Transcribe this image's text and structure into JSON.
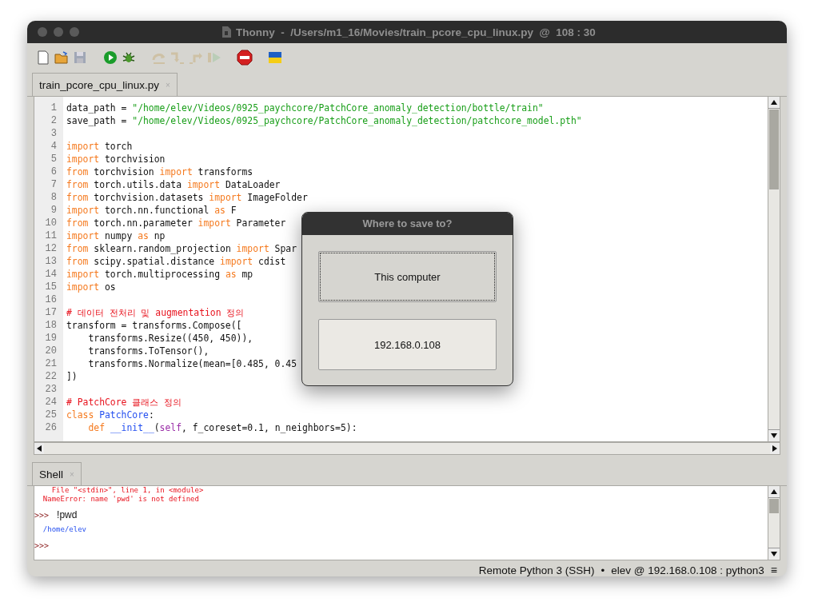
{
  "window": {
    "title": "Thonny  -  /Users/m1_16/Movies/train_pcore_cpu_linux.py  @  108 : 30"
  },
  "toolbar": [
    {
      "kind": "new",
      "disabled": false
    },
    {
      "kind": "open",
      "disabled": false
    },
    {
      "kind": "save",
      "disabled": true
    },
    {
      "kind": "run",
      "disabled": false
    },
    {
      "kind": "debug",
      "disabled": false
    },
    {
      "kind": "step-over",
      "disabled": true
    },
    {
      "kind": "step-into",
      "disabled": true
    },
    {
      "kind": "step-out",
      "disabled": true
    },
    {
      "kind": "resume",
      "disabled": true
    },
    {
      "kind": "stop",
      "disabled": false
    },
    {
      "kind": "flag",
      "disabled": false
    }
  ],
  "editor": {
    "tab": {
      "label": "train_pcore_cpu_linux.py",
      "close": "×",
      "selected": true
    },
    "lines": [
      {
        "number": "1",
        "tokens": [
          {
            "kind": "plain",
            "text": "data_path = "
          },
          {
            "kind": "string",
            "text": "\"/home/elev/Videos/0925_paychcore/PatchCore_anomaly_detection/bottle/train\""
          }
        ]
      },
      {
        "number": "2",
        "tokens": [
          {
            "kind": "plain",
            "text": "save_path = "
          },
          {
            "kind": "string",
            "text": "\"/home/elev/Videos/0925_paychcore/PatchCore_anomaly_detection/patchcore_model.pth\""
          }
        ]
      },
      {
        "number": "3"
      },
      {
        "number": "4",
        "tokens": [
          {
            "kind": "keyword",
            "text": "import"
          },
          {
            "kind": "plain",
            "text": " torch"
          }
        ]
      },
      {
        "number": "5",
        "tokens": [
          {
            "kind": "keyword",
            "text": "import"
          },
          {
            "kind": "plain",
            "text": " torchvision"
          }
        ]
      },
      {
        "number": "6",
        "tokens": [
          {
            "kind": "keyword",
            "text": "from"
          },
          {
            "kind": "plain",
            "text": " torchvision "
          },
          {
            "kind": "keyword",
            "text": "import"
          },
          {
            "kind": "plain",
            "text": " transforms"
          }
        ]
      },
      {
        "number": "7",
        "tokens": [
          {
            "kind": "keyword",
            "text": "from"
          },
          {
            "kind": "plain",
            "text": " torch.utils.data "
          },
          {
            "kind": "keyword",
            "text": "import"
          },
          {
            "kind": "plain",
            "text": " DataLoader"
          }
        ]
      },
      {
        "number": "8",
        "tokens": [
          {
            "kind": "keyword",
            "text": "from"
          },
          {
            "kind": "plain",
            "text": " torchvision.datasets "
          },
          {
            "kind": "keyword",
            "text": "import"
          },
          {
            "kind": "plain",
            "text": " ImageFolder"
          }
        ]
      },
      {
        "number": "9",
        "tokens": [
          {
            "kind": "keyword",
            "text": "import"
          },
          {
            "kind": "plain",
            "text": " torch.nn.functional "
          },
          {
            "kind": "keyword",
            "text": "as"
          },
          {
            "kind": "plain",
            "text": " F"
          }
        ]
      },
      {
        "number": "10",
        "tokens": [
          {
            "kind": "keyword",
            "text": "from"
          },
          {
            "kind": "plain",
            "text": " torch.nn.parameter "
          },
          {
            "kind": "keyword",
            "text": "import"
          },
          {
            "kind": "plain",
            "text": " Parameter"
          }
        ]
      },
      {
        "number": "11",
        "tokens": [
          {
            "kind": "keyword",
            "text": "import"
          },
          {
            "kind": "plain",
            "text": " numpy "
          },
          {
            "kind": "keyword",
            "text": "as"
          },
          {
            "kind": "plain",
            "text": " np"
          }
        ]
      },
      {
        "number": "12",
        "tokens": [
          {
            "kind": "keyword",
            "text": "from"
          },
          {
            "kind": "plain",
            "text": " sklearn.random_projection "
          },
          {
            "kind": "keyword",
            "text": "import"
          },
          {
            "kind": "plain",
            "text": " Spar"
          }
        ]
      },
      {
        "number": "13",
        "tokens": [
          {
            "kind": "keyword",
            "text": "from"
          },
          {
            "kind": "plain",
            "text": " scipy.spatial.distance "
          },
          {
            "kind": "keyword",
            "text": "import"
          },
          {
            "kind": "plain",
            "text": " cdist"
          }
        ]
      },
      {
        "number": "14",
        "tokens": [
          {
            "kind": "keyword",
            "text": "import"
          },
          {
            "kind": "plain",
            "text": " torch.multiprocessing "
          },
          {
            "kind": "keyword",
            "text": "as"
          },
          {
            "kind": "plain",
            "text": " mp"
          }
        ]
      },
      {
        "number": "15",
        "tokens": [
          {
            "kind": "keyword",
            "text": "import"
          },
          {
            "kind": "plain",
            "text": " os"
          }
        ]
      },
      {
        "number": "16"
      },
      {
        "number": "17",
        "tokens": [
          {
            "kind": "comment",
            "text": "# 데이터 전처리 및 augmentation 정의"
          }
        ]
      },
      {
        "number": "18",
        "tokens": [
          {
            "kind": "plain",
            "text": "transform = transforms.Compose(["
          }
        ]
      },
      {
        "number": "19",
        "tokens": [
          {
            "kind": "plain",
            "text": "    transforms.Resize((450, 450)),"
          }
        ]
      },
      {
        "number": "20",
        "tokens": [
          {
            "kind": "plain",
            "text": "    transforms.ToTensor(),"
          }
        ]
      },
      {
        "number": "21",
        "tokens": [
          {
            "kind": "plain",
            "text": "    transforms.Normalize(mean=[0.485, 0.45"
          }
        ]
      },
      {
        "number": "22",
        "tokens": [
          {
            "kind": "plain",
            "text": "])"
          }
        ]
      },
      {
        "number": "23"
      },
      {
        "number": "24",
        "tokens": [
          {
            "kind": "comment",
            "text": "# PatchCore 클래스 정의"
          }
        ]
      },
      {
        "number": "25",
        "tokens": [
          {
            "kind": "keyword",
            "text": "class "
          },
          {
            "kind": "name",
            "text": "PatchCore"
          },
          {
            "kind": "plain",
            "text": ":"
          }
        ]
      },
      {
        "number": "26",
        "tokens": [
          {
            "kind": "keyword",
            "text": "    def "
          },
          {
            "kind": "name",
            "text": "__init__"
          },
          {
            "kind": "plain",
            "text": "("
          },
          {
            "kind": "self",
            "text": "self"
          },
          {
            "kind": "plain",
            "text": ", f_coreset=0.1, n_neighbors=5):"
          }
        ]
      }
    ]
  },
  "shell": {
    "tab": {
      "label": "Shell",
      "close": "×",
      "selected": true
    },
    "lines": [
      {
        "kind": "error",
        "text": "    File \"<stdin>\", line 1, in <module>"
      },
      {
        "kind": "error",
        "text": "  NameError: name 'pwd' is not defined"
      },
      {
        "kind": "input",
        "prompt": ">>>",
        "text": "!pwd"
      },
      {
        "kind": "output",
        "text": "  /home/elev"
      },
      {
        "kind": "input",
        "prompt": ">>>"
      }
    ]
  },
  "dialog": {
    "title": "Where to save to?",
    "buttons": [
      {
        "label": "This computer",
        "focused": true
      },
      {
        "label": "192.168.0.108",
        "focused": false
      }
    ]
  },
  "status_bar": {
    "backend": "Remote Python 3 (SSH)",
    "separator": "•",
    "connection": "elev @ 192.168.0.108 : python3",
    "menu": "≡"
  }
}
